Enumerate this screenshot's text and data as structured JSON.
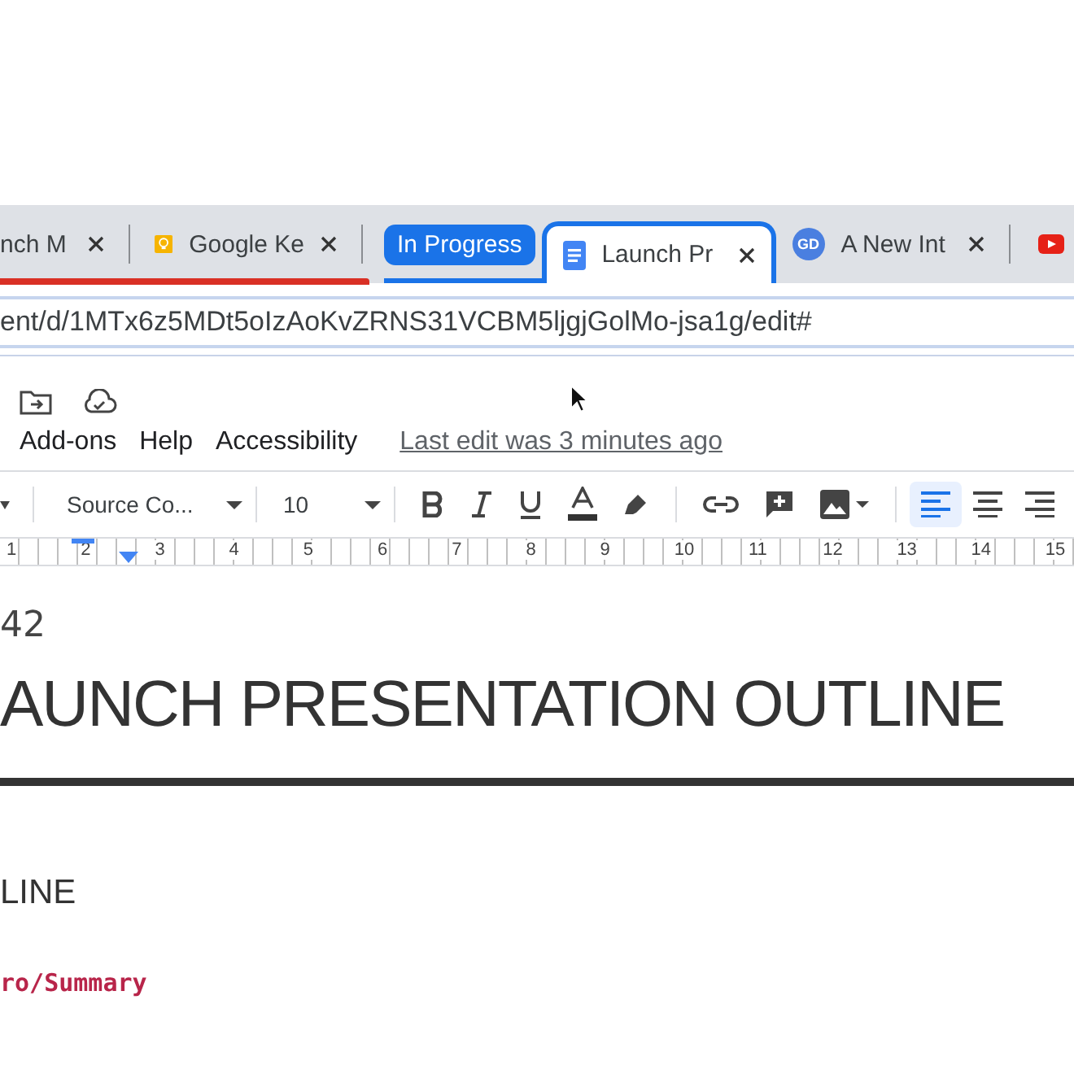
{
  "tabs": [
    {
      "kind": "plain",
      "title": "nch M",
      "selected": false,
      "color": "#d93025"
    },
    {
      "kind": "keep",
      "title": "Google Ke",
      "selected": false,
      "color": "#d93025"
    },
    {
      "kind": "group",
      "title": "In Progress",
      "selected": false,
      "color": "#1a73e8"
    },
    {
      "kind": "docs",
      "title": "Launch Pr",
      "selected": true,
      "color": "#1a73e8"
    },
    {
      "kind": "avatar",
      "title": "A New Int",
      "avatar": "GD",
      "selected": false
    },
    {
      "kind": "video",
      "selected": false
    }
  ],
  "address": "ent/d/1MTx6z5MDt5oIzAoKvZRNS31VCBM5ljgjGolMo-jsa1g/edit#",
  "menu": [
    "Add-ons",
    "Help",
    "Accessibility"
  ],
  "last_edit": "Last edit was 3 minutes ago",
  "toolbar": {
    "font": "Source Co...",
    "size": "10",
    "align": [
      {
        "kind": "left",
        "selected": true
      },
      {
        "kind": "center",
        "selected": false
      },
      {
        "kind": "right",
        "selected": false
      }
    ]
  },
  "ruler": [
    "1",
    "2",
    "3",
    "4",
    "5",
    "6",
    "7",
    "8",
    "9",
    "10",
    "11",
    "12",
    "13",
    "14",
    "15"
  ],
  "document": {
    "number": "42",
    "title": "AUNCH PRESENTATION OUTLINE",
    "subheading": "LINE",
    "section": "ro/Summary"
  }
}
